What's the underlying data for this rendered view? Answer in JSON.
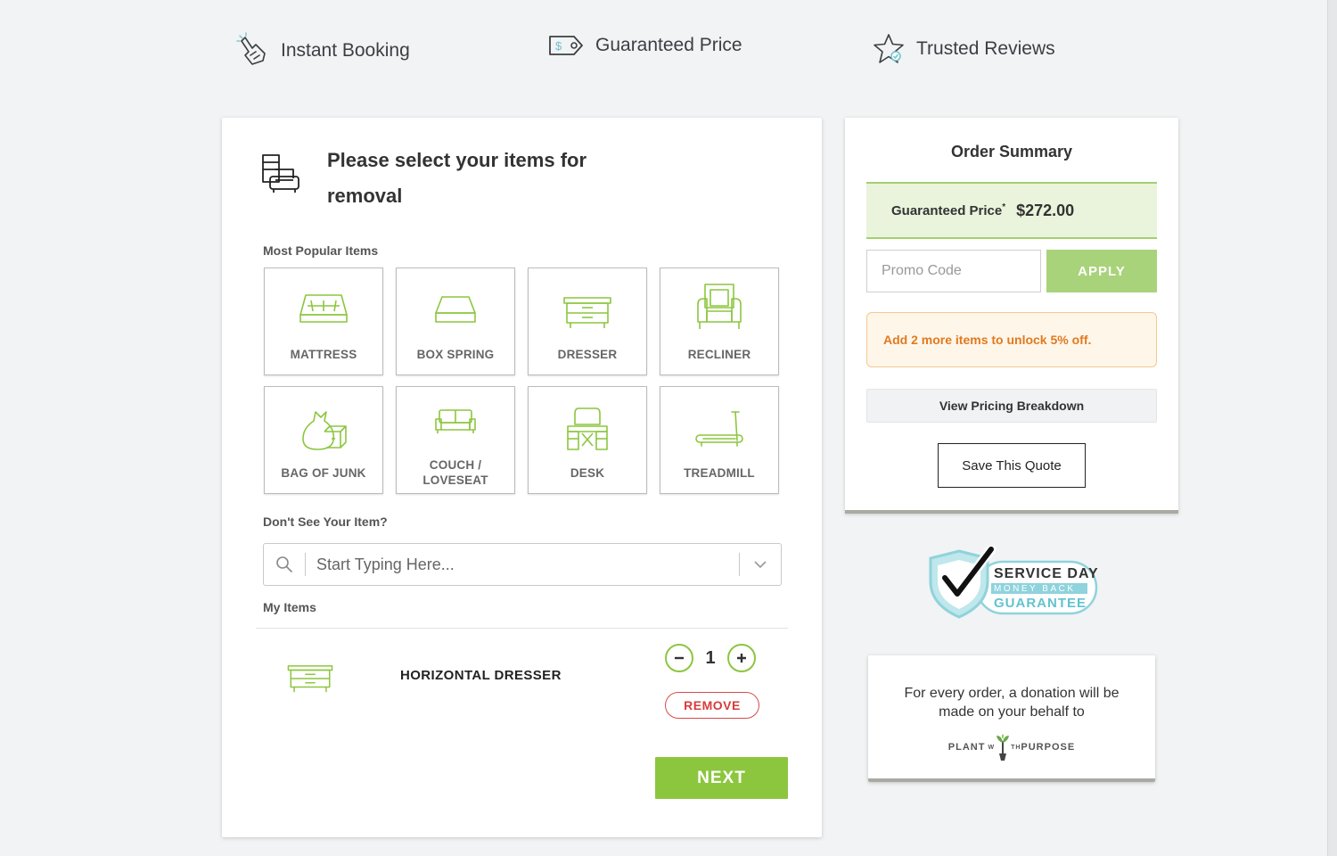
{
  "features": [
    {
      "label": "Instant Booking",
      "icon": "hand-tap-icon"
    },
    {
      "label": "Guaranteed Price",
      "icon": "price-tag-icon"
    },
    {
      "label": "Trusted Reviews",
      "icon": "star-check-icon"
    }
  ],
  "main": {
    "title": "Please select your items for removal",
    "popular_label": "Most Popular Items",
    "items": [
      {
        "label": "MATTRESS",
        "icon": "mattress-icon"
      },
      {
        "label": "BOX SPRING",
        "icon": "box-spring-icon"
      },
      {
        "label": "DRESSER",
        "icon": "dresser-icon"
      },
      {
        "label": "RECLINER",
        "icon": "recliner-icon"
      },
      {
        "label": "BAG OF JUNK",
        "icon": "junk-bag-icon"
      },
      {
        "label": "COUCH / LOVESEAT",
        "icon": "couch-icon"
      },
      {
        "label": "DESK",
        "icon": "desk-icon"
      },
      {
        "label": "TREADMILL",
        "icon": "treadmill-icon"
      }
    ],
    "search_label": "Don't See Your Item?",
    "search_placeholder": "Start Typing Here...",
    "my_items_label": "My Items",
    "my_items": [
      {
        "name": "HORIZONTAL DRESSER",
        "quantity": "1",
        "remove_label": "REMOVE",
        "icon": "dresser-icon"
      }
    ],
    "next_label": "NEXT"
  },
  "summary": {
    "title": "Order Summary",
    "price_label": "Guaranteed Price",
    "price_asterisk": "*",
    "price_value": "$272.00",
    "promo_placeholder": "Promo Code",
    "apply_label": "APPLY",
    "promo_note": "Add 2 more items to unlock 5% off.",
    "pricing_breakdown_label": "View Pricing Breakdown",
    "save_quote_label": "Save This Quote"
  },
  "guarantee": {
    "line1": "SERVICE DAY",
    "line2": "MONEY BACK",
    "line3": "GUARANTEE"
  },
  "donation": {
    "text": "For every order, a donation will be made on your behalf to",
    "logo_left": "PLANT",
    "logo_mid_w": "W",
    "logo_mid_th": "TH",
    "logo_right": "PURPOSE"
  },
  "colors": {
    "accent_green": "#8cc63f",
    "apply_green": "#a9d37a",
    "remove_red": "#d93b3b",
    "promo_orange": "#e07a1f",
    "badge_teal": "#62c3cf"
  }
}
